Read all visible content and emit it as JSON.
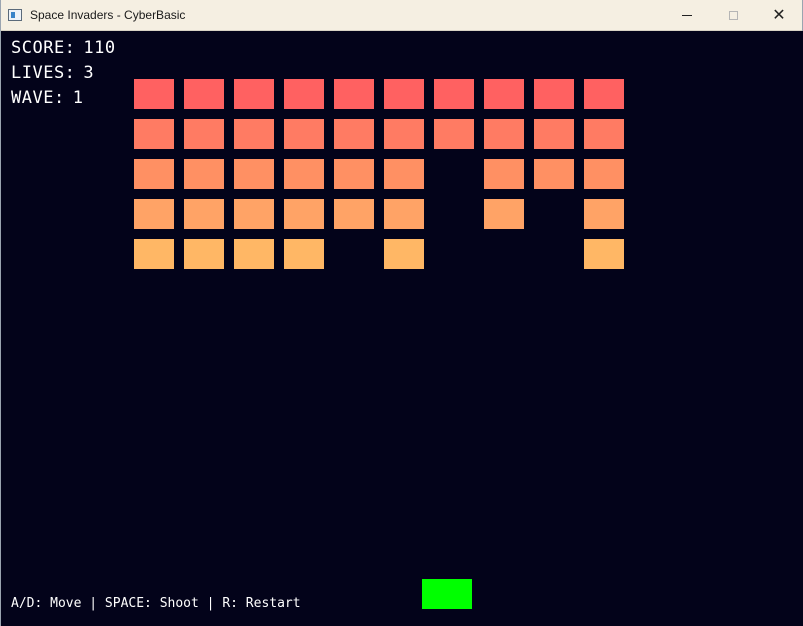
{
  "window": {
    "title": "Space Invaders - CyberBasic",
    "icons": [
      "app-icon",
      "minimize-icon",
      "maximize-icon",
      "close-icon"
    ],
    "close_glyph": "✕"
  },
  "hud": {
    "score_label": "SCORE:",
    "score_value": "110",
    "lives_label": "LIVES:",
    "lives_value": "3",
    "wave_label": "WAVE:",
    "wave_value": "1"
  },
  "invaders": {
    "columns": 10,
    "row_colors": [
      "#ff6161",
      "#ff7b63",
      "#ff9063",
      "#ffa366",
      "#ffb765"
    ],
    "grid": [
      [
        1,
        1,
        1,
        1,
        1,
        1,
        1,
        1,
        1,
        1
      ],
      [
        1,
        1,
        1,
        1,
        1,
        1,
        1,
        1,
        1,
        1
      ],
      [
        1,
        1,
        1,
        1,
        1,
        1,
        0,
        1,
        1,
        1
      ],
      [
        1,
        1,
        1,
        1,
        1,
        1,
        0,
        1,
        0,
        1
      ],
      [
        1,
        1,
        1,
        1,
        0,
        1,
        0,
        0,
        0,
        1
      ]
    ]
  },
  "player": {
    "color": "#00ff00"
  },
  "help": {
    "text": "A/D: Move | SPACE: Shoot | R: Restart"
  },
  "colors": {
    "background": "#03031a",
    "hud_text": "#ffffff"
  }
}
